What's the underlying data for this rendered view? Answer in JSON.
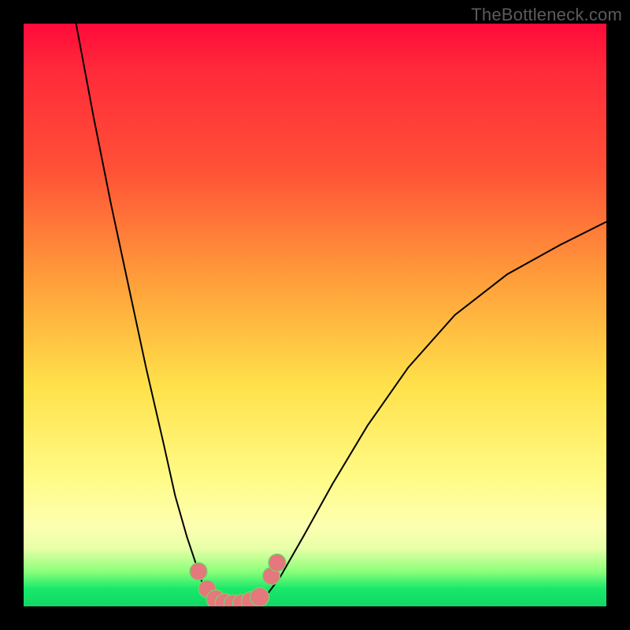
{
  "attribution": "TheBottleneck.com",
  "colors": {
    "background": "#000000",
    "gradient_top": "#ff0a3a",
    "gradient_mid": "#ffe14a",
    "gradient_bottom": "#11d766",
    "curve": "#000000",
    "marker_fill": "#e4787c",
    "marker_stroke": "#6ed86a"
  },
  "chart_data": {
    "type": "line",
    "title": "",
    "xlabel": "",
    "ylabel": "",
    "xlim": [
      0,
      100
    ],
    "ylim": [
      0,
      100
    ],
    "grid": false,
    "legend": false,
    "series": [
      {
        "name": "left-branch",
        "x": [
          9,
          12,
          15,
          18,
          21,
          24,
          26,
          28,
          30,
          31,
          32,
          33
        ],
        "y": [
          100,
          84,
          69,
          55,
          41,
          28,
          19,
          12,
          6,
          3,
          1.5,
          0.5
        ]
      },
      {
        "name": "valley",
        "x": [
          33,
          34,
          35,
          36,
          37,
          38,
          39,
          40,
          41
        ],
        "y": [
          0.5,
          0.2,
          0.1,
          0.1,
          0.1,
          0.2,
          0.3,
          0.5,
          1
        ]
      },
      {
        "name": "right-branch",
        "x": [
          41,
          44,
          48,
          53,
          59,
          66,
          74,
          83,
          92,
          100
        ],
        "y": [
          1,
          5,
          12,
          21,
          31,
          41,
          50,
          57,
          62,
          66
        ]
      }
    ],
    "markers": {
      "name": "bottleneck-region",
      "x": [
        30,
        31.5,
        33,
        34.5,
        36,
        37.5,
        39,
        40.5,
        42.5,
        43.5
      ],
      "y": [
        6,
        3,
        1.2,
        0.6,
        0.4,
        0.5,
        0.9,
        1.6,
        5.2,
        7.5
      ],
      "r": [
        11,
        11,
        12,
        12,
        12,
        12,
        12,
        12,
        11,
        11
      ]
    }
  }
}
